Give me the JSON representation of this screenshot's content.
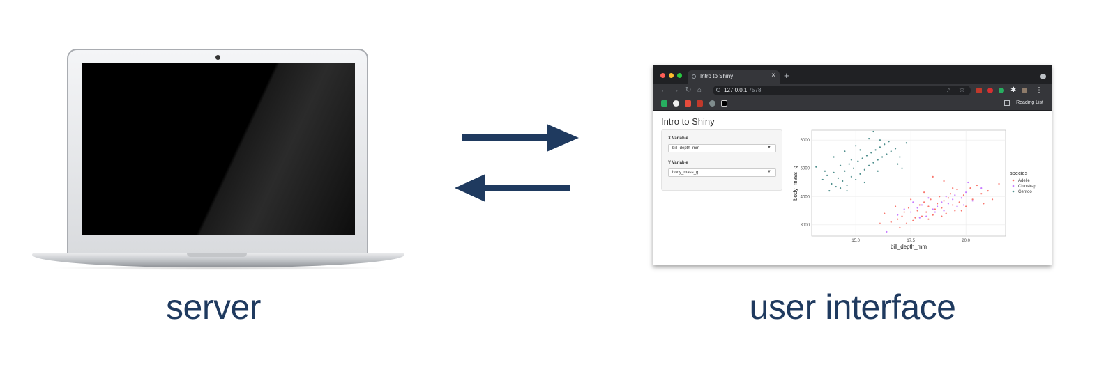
{
  "captions": {
    "server": "server",
    "user_interface": "user interface"
  },
  "colors": {
    "caption": "#1f3a5f",
    "arrow": "#1f3a5f",
    "adelie": "#F8766D",
    "chinstrap": "#C77CFF",
    "gentoo": "#4E8E8C"
  },
  "browser": {
    "tab_title": "Intro to Shiny",
    "url_host": "127.0.0.1",
    "url_port": ":7578",
    "reading_list": "Reading List"
  },
  "app": {
    "title": "Intro to Shiny",
    "x_label": "X Variable",
    "x_value": "bill_depth_mm",
    "y_label": "Y Variable",
    "y_value": "body_mass_g"
  },
  "chart_data": {
    "type": "scatter",
    "xlabel": "bill_depth_mm",
    "ylabel": "body_mass_g",
    "xlim": [
      13.0,
      21.8
    ],
    "ylim": [
      2600,
      6350
    ],
    "x_ticks": [
      15.0,
      17.5,
      20.0
    ],
    "x_tick_labels": [
      "15.0",
      "17.5",
      "20.0"
    ],
    "y_ticks": [
      3000,
      4000,
      5000,
      6000
    ],
    "y_tick_labels": [
      "3000",
      "4000",
      "5000",
      "6000"
    ],
    "grid": true,
    "legend_title": "species",
    "legend_position": "right",
    "series": [
      {
        "name": "Adelie",
        "points": [
          [
            16.1,
            3050
          ],
          [
            16.6,
            3100
          ],
          [
            16.9,
            3200
          ],
          [
            17.1,
            3300
          ],
          [
            17.2,
            3450
          ],
          [
            17.4,
            3600
          ],
          [
            17.6,
            3150
          ],
          [
            17.8,
            3500
          ],
          [
            17.9,
            3700
          ],
          [
            18.0,
            3300
          ],
          [
            18.1,
            3800
          ],
          [
            18.2,
            3450
          ],
          [
            18.3,
            3650
          ],
          [
            18.4,
            3900
          ],
          [
            18.5,
            3350
          ],
          [
            18.6,
            3550
          ],
          [
            18.7,
            3750
          ],
          [
            18.8,
            4000
          ],
          [
            18.9,
            3600
          ],
          [
            19.0,
            3850
          ],
          [
            19.1,
            3400
          ],
          [
            19.2,
            3950
          ],
          [
            19.3,
            4100
          ],
          [
            19.4,
            3700
          ],
          [
            19.5,
            3500
          ],
          [
            19.6,
            4250
          ],
          [
            19.7,
            3800
          ],
          [
            19.9,
            4050
          ],
          [
            20.0,
            3650
          ],
          [
            20.2,
            4300
          ],
          [
            20.3,
            3900
          ],
          [
            20.5,
            4400
          ],
          [
            20.7,
            4100
          ],
          [
            21.0,
            4200
          ],
          [
            21.2,
            3900
          ],
          [
            21.5,
            4450
          ],
          [
            17.0,
            2900
          ],
          [
            17.3,
            3050
          ],
          [
            17.7,
            3250
          ],
          [
            18.3,
            3200
          ],
          [
            18.9,
            3300
          ],
          [
            19.8,
            3500
          ],
          [
            16.3,
            3400
          ],
          [
            16.8,
            3650
          ],
          [
            19.0,
            4550
          ],
          [
            18.5,
            4700
          ],
          [
            20.8,
            3750
          ],
          [
            17.5,
            3900
          ],
          [
            18.1,
            4150
          ],
          [
            19.4,
            4300
          ]
        ]
      },
      {
        "name": "Chinstrap",
        "points": [
          [
            16.4,
            2750
          ],
          [
            16.9,
            3350
          ],
          [
            17.2,
            3550
          ],
          [
            17.5,
            3450
          ],
          [
            17.8,
            3600
          ],
          [
            18.0,
            3700
          ],
          [
            18.2,
            3300
          ],
          [
            18.3,
            3950
          ],
          [
            18.5,
            3550
          ],
          [
            18.7,
            3650
          ],
          [
            18.9,
            3800
          ],
          [
            19.0,
            3500
          ],
          [
            19.2,
            3750
          ],
          [
            19.4,
            3900
          ],
          [
            19.5,
            4050
          ],
          [
            19.6,
            3650
          ],
          [
            19.8,
            3950
          ],
          [
            20.0,
            4150
          ],
          [
            20.3,
            3850
          ],
          [
            20.7,
            4300
          ],
          [
            17.9,
            3250
          ],
          [
            18.6,
            3450
          ],
          [
            19.1,
            4000
          ],
          [
            19.9,
            3700
          ],
          [
            17.6,
            3800
          ],
          [
            20.1,
            4500
          ]
        ]
      },
      {
        "name": "Gentoo",
        "points": [
          [
            13.2,
            5050
          ],
          [
            13.5,
            4600
          ],
          [
            13.7,
            4750
          ],
          [
            13.9,
            4450
          ],
          [
            14.0,
            4850
          ],
          [
            14.1,
            4350
          ],
          [
            14.2,
            4650
          ],
          [
            14.3,
            5100
          ],
          [
            14.4,
            4550
          ],
          [
            14.5,
            4900
          ],
          [
            14.6,
            4400
          ],
          [
            14.7,
            5150
          ],
          [
            14.8,
            4700
          ],
          [
            14.9,
            5000
          ],
          [
            15.0,
            4600
          ],
          [
            15.1,
            5250
          ],
          [
            15.2,
            4800
          ],
          [
            15.3,
            5350
          ],
          [
            15.4,
            4950
          ],
          [
            15.5,
            5450
          ],
          [
            15.6,
            5100
          ],
          [
            15.7,
            5550
          ],
          [
            15.8,
            5200
          ],
          [
            15.9,
            5650
          ],
          [
            16.0,
            5300
          ],
          [
            16.1,
            5750
          ],
          [
            16.2,
            5400
          ],
          [
            16.3,
            5850
          ],
          [
            16.4,
            5500
          ],
          [
            16.5,
            5950
          ],
          [
            16.6,
            5600
          ],
          [
            16.8,
            5700
          ],
          [
            17.0,
            5400
          ],
          [
            17.3,
            5900
          ],
          [
            14.5,
            5600
          ],
          [
            14.0,
            5400
          ],
          [
            15.0,
            5800
          ],
          [
            15.6,
            6050
          ],
          [
            16.1,
            6000
          ],
          [
            14.3,
            4300
          ],
          [
            13.8,
            4200
          ],
          [
            15.4,
            4500
          ],
          [
            16.0,
            4900
          ],
          [
            15.2,
            5650
          ],
          [
            14.8,
            5300
          ],
          [
            16.9,
            5150
          ],
          [
            13.6,
            4900
          ],
          [
            15.8,
            6300
          ],
          [
            17.1,
            5000
          ],
          [
            14.6,
            4200
          ]
        ]
      }
    ]
  }
}
